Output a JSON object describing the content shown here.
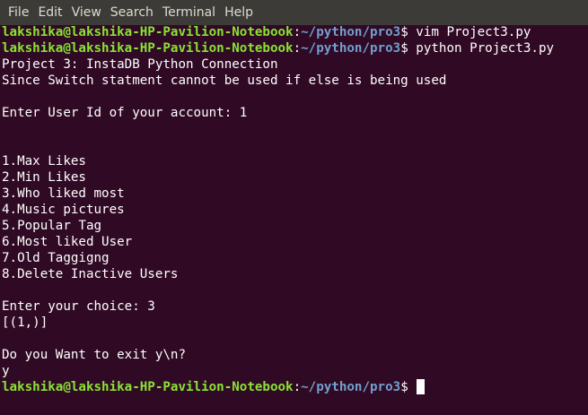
{
  "menu": {
    "items": [
      "File",
      "Edit",
      "View",
      "Search",
      "Terminal",
      "Help"
    ]
  },
  "prompt": {
    "user_host": "lakshika@lakshika-HP-Pavilion-Notebook",
    "separator": ":",
    "path": "~/python/pro3",
    "symbol": "$"
  },
  "lines": [
    {
      "type": "prompt",
      "command": " vim Project3.py"
    },
    {
      "type": "prompt",
      "command": " python Project3.py"
    },
    {
      "type": "text",
      "text": "Project 3: InstaDB Python Connection"
    },
    {
      "type": "text",
      "text": "Since Switch statment cannot be used if else is being used"
    },
    {
      "type": "text",
      "text": ""
    },
    {
      "type": "text",
      "text": "Enter User Id of your account: 1"
    },
    {
      "type": "text",
      "text": ""
    },
    {
      "type": "text",
      "text": ""
    },
    {
      "type": "text",
      "text": "1.Max Likes"
    },
    {
      "type": "text",
      "text": "2.Min Likes"
    },
    {
      "type": "text",
      "text": "3.Who liked most"
    },
    {
      "type": "text",
      "text": "4.Music pictures"
    },
    {
      "type": "text",
      "text": "5.Popular Tag"
    },
    {
      "type": "text",
      "text": "6.Most liked User"
    },
    {
      "type": "text",
      "text": "7.Old Taggigng"
    },
    {
      "type": "text",
      "text": "8.Delete Inactive Users"
    },
    {
      "type": "text",
      "text": ""
    },
    {
      "type": "text",
      "text": "Enter your choice: 3"
    },
    {
      "type": "text",
      "text": "[(1,)]"
    },
    {
      "type": "text",
      "text": ""
    },
    {
      "type": "text",
      "text": "Do you Want to exit y\\n?"
    },
    {
      "type": "text",
      "text": "y"
    },
    {
      "type": "prompt",
      "command": " ",
      "cursor": true
    }
  ],
  "colors": {
    "background": "#300a24",
    "menubar": "#3c3b37",
    "user_host": "#8ae234",
    "path": "#729fcf",
    "text": "#ffffff"
  }
}
